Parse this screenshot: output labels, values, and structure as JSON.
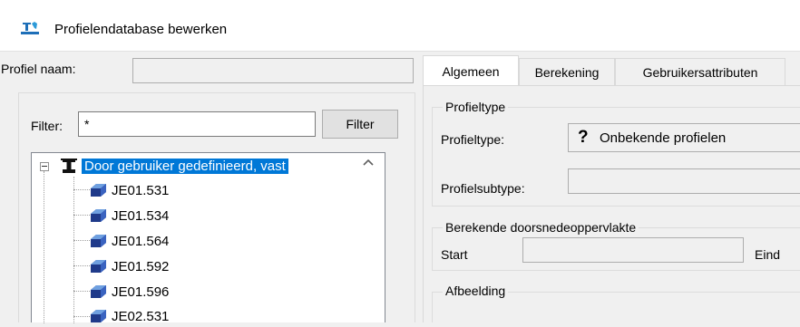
{
  "window": {
    "title": "Profielendatabase bewerken",
    "icon": "profile-database-icon"
  },
  "profile_name": {
    "label": "Profiel naam:",
    "value": ""
  },
  "filter": {
    "label": "Filter:",
    "value": "*",
    "button": "Filter"
  },
  "tree": {
    "root": {
      "label": "Door gebruiker gedefinieerd, vast",
      "icon": "i-beam-icon",
      "expanded": true,
      "selected": true
    },
    "items": [
      {
        "label": "JE01.531",
        "icon": "profile-shape-icon"
      },
      {
        "label": "JE01.534",
        "icon": "profile-shape-icon"
      },
      {
        "label": "JE01.564",
        "icon": "profile-shape-icon"
      },
      {
        "label": "JE01.592",
        "icon": "profile-shape-icon"
      },
      {
        "label": "JE01.596",
        "icon": "profile-shape-icon"
      },
      {
        "label": "JE02.531",
        "icon": "profile-shape-icon"
      }
    ]
  },
  "tabs": [
    {
      "label": "Algemeen",
      "active": true
    },
    {
      "label": "Berekening",
      "active": false
    },
    {
      "label": "Gebruikersattributen",
      "active": false
    }
  ],
  "general": {
    "profiletype_group": "Profieltype",
    "profiletype_label": "Profieltype:",
    "profiletype_value": "Onbekende profielen",
    "profiletype_icon": "question-mark-icon",
    "subtype_label": "Profielsubtype:",
    "subtype_value": "",
    "area_group": "Berekende doorsnedeoppervlakte",
    "start_label": "Start",
    "start_value": "",
    "end_label": "Eind",
    "image_group": "Afbeelding"
  },
  "colors": {
    "selection": "#0078d7",
    "window_bg": "#f0f0f0"
  }
}
